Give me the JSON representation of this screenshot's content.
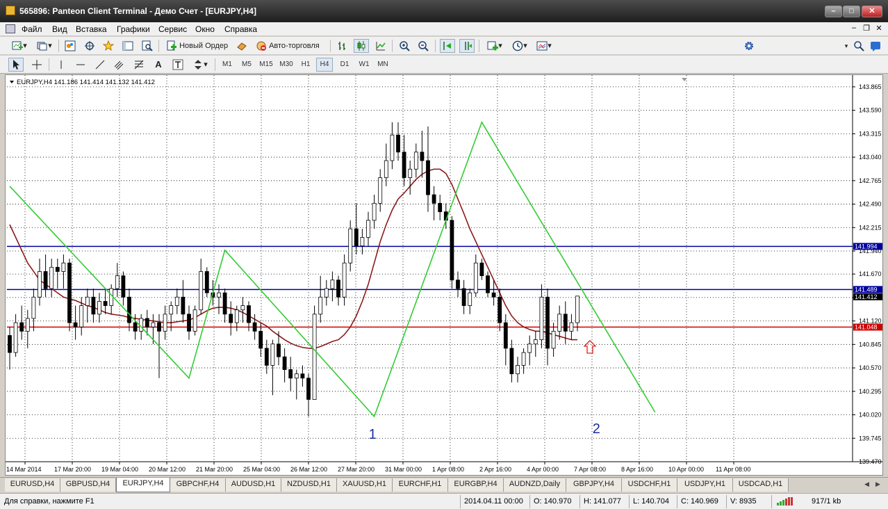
{
  "window": {
    "title": "565896: Panteon Client Terminal - Демо Счет - [EURJPY,H4]"
  },
  "menu": [
    "Файл",
    "Вид",
    "Вставка",
    "Графики",
    "Сервис",
    "Окно",
    "Справка"
  ],
  "toolbar": {
    "new_order": "Новый Ордер",
    "autotrading": "Авто-торговля"
  },
  "timeframes": [
    "M1",
    "M5",
    "M15",
    "M30",
    "H1",
    "H4",
    "D1",
    "W1",
    "MN"
  ],
  "active_timeframe": "H4",
  "chart_data": {
    "type": "candlestick",
    "symbol": "EURJPY",
    "timeframe": "H4",
    "header": "EURJPY,H4  141.186 141.414 141.132 141.412",
    "ohlc_last": {
      "open": 141.186,
      "high": 141.414,
      "low": 141.132,
      "close": 141.412
    },
    "y_ticks": [
      "143.865",
      "143.590",
      "143.315",
      "143.040",
      "142.765",
      "142.490",
      "142.215",
      "141.940",
      "141.670",
      "141.395",
      "141.120",
      "140.845",
      "140.570",
      "140.295",
      "140.020",
      "139.745",
      "139.470"
    ],
    "ylim": [
      139.47,
      143.97
    ],
    "x_ticks": [
      "14 Mar 2014",
      "17 Mar 20:00",
      "19 Mar 04:00",
      "20 Mar 12:00",
      "21 Mar 20:00",
      "25 Mar 04:00",
      "26 Mar 12:00",
      "27 Mar 20:00",
      "31 Mar 00:00",
      "1 Apr 08:00",
      "2 Apr 16:00",
      "4 Apr 00:00",
      "7 Apr 08:00",
      "8 Apr 16:00",
      "10 Apr 00:00",
      "11 Apr 08:00"
    ],
    "hlines": [
      {
        "price": 141.994,
        "label": "141.994",
        "color": "#0000a0"
      },
      {
        "price": 141.489,
        "label": "141.489",
        "color": "#0000a0"
      },
      {
        "price": 141.048,
        "label": "141.048",
        "color": "#d00000"
      }
    ],
    "current_price_label": "141.412",
    "candles": [
      [
        140.95,
        141.05,
        140.55,
        140.75
      ],
      [
        140.75,
        141.2,
        140.7,
        141.1
      ],
      [
        141.1,
        141.3,
        140.9,
        141.0
      ],
      [
        141.0,
        141.25,
        140.8,
        141.15
      ],
      [
        141.15,
        141.5,
        141.0,
        141.4
      ],
      [
        141.4,
        141.85,
        141.3,
        141.7
      ],
      [
        141.7,
        141.9,
        141.4,
        141.5
      ],
      [
        141.5,
        141.85,
        141.4,
        141.75
      ],
      [
        141.75,
        141.85,
        141.5,
        141.7
      ],
      [
        141.7,
        141.9,
        141.5,
        141.8
      ],
      [
        141.8,
        141.85,
        141.0,
        141.1
      ],
      [
        141.1,
        141.3,
        140.9,
        141.05
      ],
      [
        141.05,
        141.4,
        140.95,
        141.3
      ],
      [
        141.3,
        141.5,
        141.1,
        141.4
      ],
      [
        141.4,
        141.5,
        141.1,
        141.2
      ],
      [
        141.2,
        141.45,
        141.1,
        141.35
      ],
      [
        141.35,
        141.5,
        141.2,
        141.3
      ],
      [
        141.3,
        141.55,
        141.2,
        141.5
      ],
      [
        141.5,
        141.8,
        141.4,
        141.65
      ],
      [
        141.65,
        141.7,
        141.3,
        141.4
      ],
      [
        141.4,
        141.5,
        141.0,
        141.1
      ],
      [
        141.1,
        141.2,
        140.9,
        141.0
      ],
      [
        141.0,
        141.2,
        140.9,
        141.15
      ],
      [
        141.15,
        141.25,
        140.95,
        141.05
      ],
      [
        141.05,
        141.2,
        140.85,
        141.1
      ],
      [
        141.1,
        141.2,
        140.45,
        141.0
      ],
      [
        141.0,
        141.3,
        140.9,
        141.2
      ],
      [
        141.2,
        141.35,
        141.0,
        141.3
      ],
      [
        141.3,
        141.5,
        141.2,
        141.4
      ],
      [
        141.4,
        141.6,
        141.1,
        141.2
      ],
      [
        141.2,
        141.3,
        140.9,
        141.0
      ],
      [
        141.0,
        141.3,
        140.95,
        141.25
      ],
      [
        141.25,
        141.85,
        141.2,
        141.7
      ],
      [
        141.7,
        141.75,
        141.4,
        141.45
      ],
      [
        141.45,
        141.6,
        141.3,
        141.4
      ],
      [
        141.4,
        141.55,
        141.2,
        141.45
      ],
      [
        141.45,
        141.5,
        141.1,
        141.2
      ],
      [
        141.2,
        141.35,
        140.95,
        141.1
      ],
      [
        141.1,
        141.3,
        141.0,
        141.25
      ],
      [
        141.25,
        141.4,
        141.1,
        141.3
      ],
      [
        141.3,
        141.35,
        141.0,
        141.1
      ],
      [
        141.1,
        141.2,
        140.9,
        141.0
      ],
      [
        141.0,
        141.1,
        140.7,
        140.8
      ],
      [
        140.8,
        140.9,
        140.5,
        140.6
      ],
      [
        140.6,
        140.9,
        140.25,
        140.85
      ],
      [
        140.85,
        141.0,
        140.6,
        140.7
      ],
      [
        140.7,
        140.8,
        140.4,
        140.55
      ],
      [
        140.55,
        140.7,
        140.3,
        140.45
      ],
      [
        140.45,
        140.55,
        140.2,
        140.5
      ],
      [
        140.5,
        140.6,
        140.35,
        140.45
      ],
      [
        140.45,
        140.5,
        140.0,
        140.2
      ],
      [
        140.2,
        141.3,
        140.2,
        141.2
      ],
      [
        141.2,
        141.65,
        141.1,
        141.4
      ],
      [
        141.4,
        141.6,
        141.3,
        141.5
      ],
      [
        141.5,
        141.7,
        141.35,
        141.6
      ],
      [
        141.6,
        141.65,
        141.3,
        141.4
      ],
      [
        141.4,
        141.9,
        141.3,
        141.8
      ],
      [
        141.8,
        142.3,
        141.7,
        142.2
      ],
      [
        142.2,
        142.5,
        141.9,
        142.0
      ],
      [
        142.0,
        142.2,
        141.9,
        142.1
      ],
      [
        142.1,
        142.4,
        142.0,
        142.3
      ],
      [
        142.3,
        142.6,
        142.2,
        142.5
      ],
      [
        142.5,
        142.9,
        142.4,
        142.8
      ],
      [
        142.8,
        143.2,
        142.7,
        143.0
      ],
      [
        143.0,
        143.45,
        142.9,
        143.3
      ],
      [
        143.3,
        143.45,
        143.0,
        143.1
      ],
      [
        143.1,
        143.3,
        142.7,
        142.8
      ],
      [
        142.8,
        143.0,
        142.6,
        142.9
      ],
      [
        142.9,
        143.2,
        142.8,
        143.1
      ],
      [
        143.1,
        143.35,
        142.8,
        143.0
      ],
      [
        143.0,
        143.4,
        142.4,
        142.6
      ],
      [
        142.6,
        142.7,
        142.3,
        142.5
      ],
      [
        142.5,
        142.6,
        142.3,
        142.4
      ],
      [
        142.4,
        142.5,
        142.2,
        142.3
      ],
      [
        142.3,
        142.35,
        141.5,
        141.6
      ],
      [
        141.6,
        141.7,
        141.4,
        141.5
      ],
      [
        141.5,
        141.6,
        141.2,
        141.3
      ],
      [
        141.3,
        141.5,
        141.2,
        141.45
      ],
      [
        141.45,
        141.9,
        141.4,
        141.8
      ],
      [
        141.8,
        141.85,
        141.6,
        141.65
      ],
      [
        141.65,
        141.7,
        141.4,
        141.45
      ],
      [
        141.45,
        141.6,
        141.3,
        141.4
      ],
      [
        141.4,
        141.5,
        141.0,
        141.1
      ],
      [
        141.1,
        141.2,
        140.6,
        140.8
      ],
      [
        140.8,
        140.9,
        140.4,
        140.5
      ],
      [
        140.5,
        140.7,
        140.4,
        140.6
      ],
      [
        140.6,
        140.8,
        140.5,
        140.75
      ],
      [
        140.75,
        140.95,
        140.6,
        140.85
      ],
      [
        140.85,
        141.0,
        140.7,
        140.9
      ],
      [
        140.9,
        141.55,
        140.8,
        141.4
      ],
      [
        141.4,
        141.5,
        140.6,
        140.8
      ],
      [
        140.8,
        141.1,
        140.7,
        141.0
      ],
      [
        141.0,
        141.3,
        140.9,
        141.2
      ],
      [
        141.2,
        141.35,
        140.85,
        141.0
      ],
      [
        141.0,
        141.2,
        140.9,
        141.1
      ],
      [
        141.1,
        141.414,
        141.0,
        141.412
      ]
    ],
    "ma": [
      142.25,
      142.1,
      141.95,
      141.8,
      141.7,
      141.6,
      141.55,
      141.5,
      141.45,
      141.4,
      141.38,
      141.36,
      141.33,
      141.3,
      141.28,
      141.25,
      141.22,
      141.2,
      141.19,
      141.18,
      141.16,
      141.15,
      141.14,
      141.13,
      141.12,
      141.11,
      141.1,
      141.1,
      141.11,
      141.12,
      141.13,
      141.16,
      141.2,
      141.24,
      141.27,
      141.28,
      141.28,
      141.27,
      141.25,
      141.22,
      141.18,
      141.14,
      141.1,
      141.06,
      141.0,
      140.95,
      140.9,
      140.86,
      140.83,
      140.81,
      140.8,
      140.8,
      140.82,
      140.85,
      140.88,
      140.9,
      140.96,
      141.05,
      141.18,
      141.35,
      141.55,
      141.8,
      142.05,
      142.25,
      142.42,
      142.55,
      142.62,
      142.7,
      142.78,
      142.84,
      142.88,
      142.9,
      142.9,
      142.85,
      142.72,
      142.55,
      142.38,
      142.2,
      142.05,
      141.9,
      141.75,
      141.6,
      141.45,
      141.3,
      141.18,
      141.1,
      141.05,
      141.02,
      141.0,
      141.0,
      140.98,
      140.96,
      140.94,
      140.92,
      140.9,
      140.9
    ],
    "zigzag": [
      [
        0,
        142.7
      ],
      [
        30,
        140.45
      ],
      [
        36,
        141.95
      ],
      [
        61,
        140.0
      ],
      [
        79,
        143.45
      ],
      [
        108,
        140.05
      ]
    ],
    "wave_labels": [
      "1",
      "2"
    ]
  },
  "tabs": [
    "EURUSD,H4",
    "GBPUSD,H4",
    "EURJPY,H4",
    "GBPCHF,H4",
    "AUDUSD,H1",
    "NZDUSD,H1",
    "XAUUSD,H1",
    "EURCHF,H1",
    "EURGBP,H4",
    "AUDNZD,Daily",
    "GBPJPY,H4",
    "USDCHF,H1",
    "USDJPY,H1",
    "USDCAD,H1"
  ],
  "active_tab": "EURJPY,H4",
  "status": {
    "help": "Для справки, нажмите F1",
    "datetime": "2014.04.11 00:00",
    "open": "O: 140.970",
    "high": "H: 141.077",
    "low": "L: 140.704",
    "close": "C: 140.969",
    "volume": "V: 8935",
    "traffic": "917/1 kb"
  },
  "colors": {
    "bull": "#ffffff",
    "bear": "#000000",
    "ma": "#8b1a1a",
    "zigzag": "#33cc33",
    "grid": "#000000",
    "arrow": "#e02020",
    "wave_label": "#1a2ea0"
  }
}
